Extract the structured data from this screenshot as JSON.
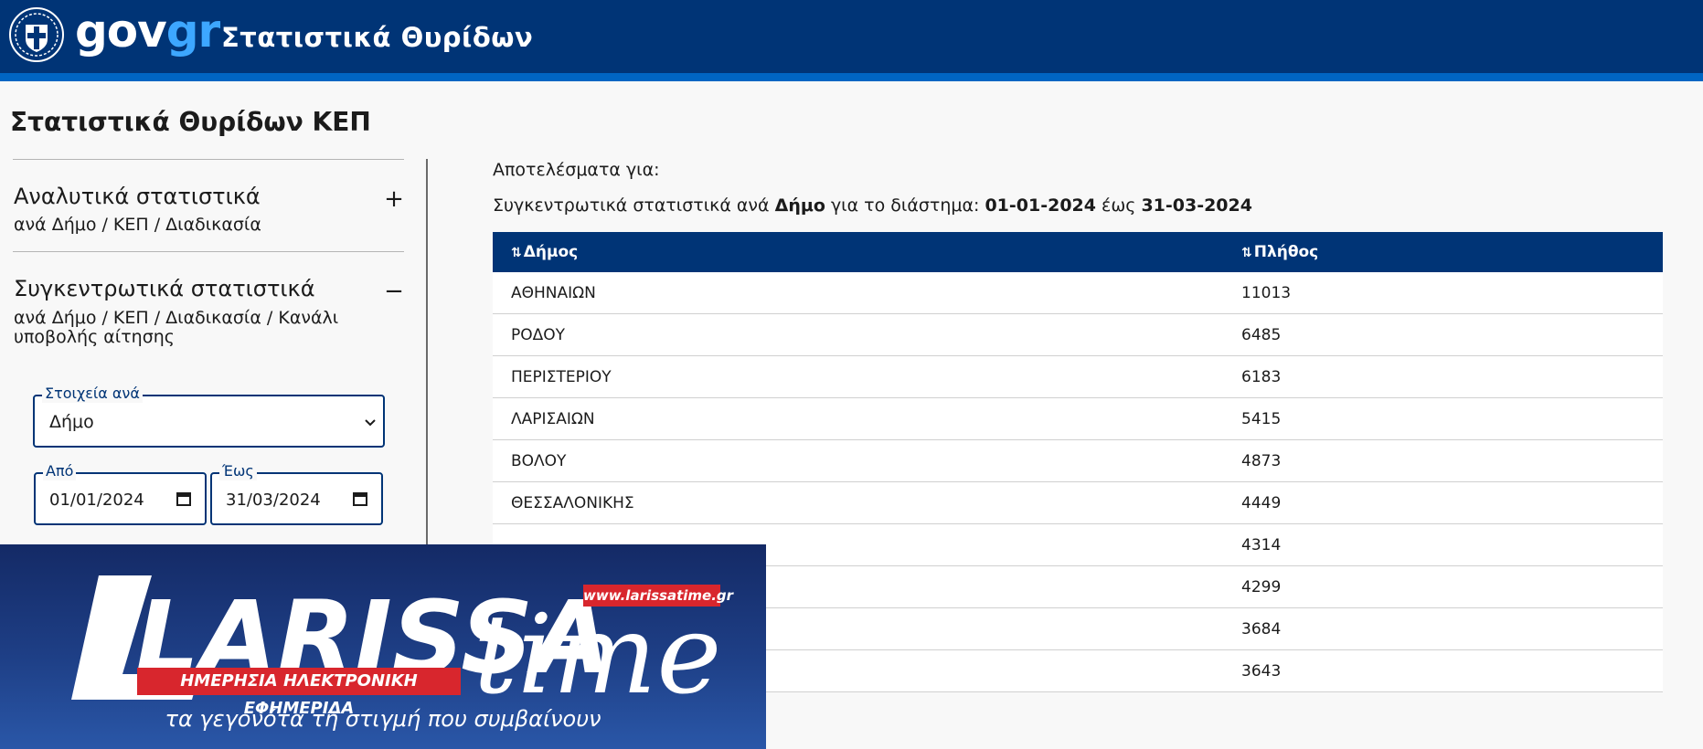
{
  "header": {
    "brand_gov": "gov",
    "brand_gr": "gr",
    "app_title": "Στατιστικά Θυρίδων",
    "colors": {
      "bar": "#003476",
      "stripe": "#0065c3",
      "accent": "#3da7ff"
    }
  },
  "page": {
    "title": "Στατιστικά Θυρίδων ΚΕΠ"
  },
  "sidebar": {
    "sections": [
      {
        "title": "Αναλυτικά στατιστικά",
        "subtitle": "ανά Δήμο / ΚΕΠ / Διαδικασία",
        "toggle": "+",
        "expanded": false
      },
      {
        "title": "Συγκεντρωτικά στατιστικά",
        "subtitle": "ανά Δήμο / ΚΕΠ / Διαδικασία / Κανάλι υποβολής αίτησης",
        "toggle": "−",
        "expanded": true
      }
    ],
    "group_by": {
      "label": "Στοιχεία ανά",
      "value": "Δήμο"
    },
    "date_from": {
      "label": "Από",
      "value": "01/01/2024"
    },
    "date_to": {
      "label": "Έως",
      "value": "31/03/2024"
    }
  },
  "results": {
    "label": "Αποτελέσματα για:",
    "summary_prefix": "Συγκεντρωτικά στατιστικά ανά",
    "summary_dim": "Δήμο",
    "summary_mid": "για το διάστημα:",
    "summary_from": "01-01-2024",
    "summary_sep": "έως",
    "summary_to": "31-03-2024",
    "columns": [
      "Δήμος",
      "Πλήθος"
    ],
    "sort_icon": "⇅",
    "rows": [
      {
        "municipality": "ΑΘΗΝΑΙΩΝ",
        "count": "11013"
      },
      {
        "municipality": "ΡΟΔΟΥ",
        "count": "6485"
      },
      {
        "municipality": "ΠΕΡΙΣΤΕΡΙΟΥ",
        "count": "6183"
      },
      {
        "municipality": "ΛΑΡΙΣΑΙΩΝ",
        "count": "5415"
      },
      {
        "municipality": "ΒΟΛΟΥ",
        "count": "4873"
      },
      {
        "municipality": "ΘΕΣΣΑΛΟΝΙΚΗΣ",
        "count": "4449"
      },
      {
        "municipality": "",
        "count": "4314"
      },
      {
        "municipality": "",
        "count": "4299"
      },
      {
        "municipality": "",
        "count": "3684"
      },
      {
        "municipality": "",
        "count": "3643"
      }
    ]
  },
  "ad": {
    "logo_text_1": "LARISSA",
    "logo_text_2": "time",
    "url": "www.larissatime.gr",
    "strip": "ΗΜΕΡΗΣΙΑ ΗΛΕΚΤΡΟΝΙΚΗ ΕΦΗΜΕΡΙΔΑ",
    "tagline": "τα γεγονότα τη στιγμή που συμβαίνουν",
    "colors": {
      "red": "#d8262d",
      "blue": "#1e3f86"
    }
  }
}
